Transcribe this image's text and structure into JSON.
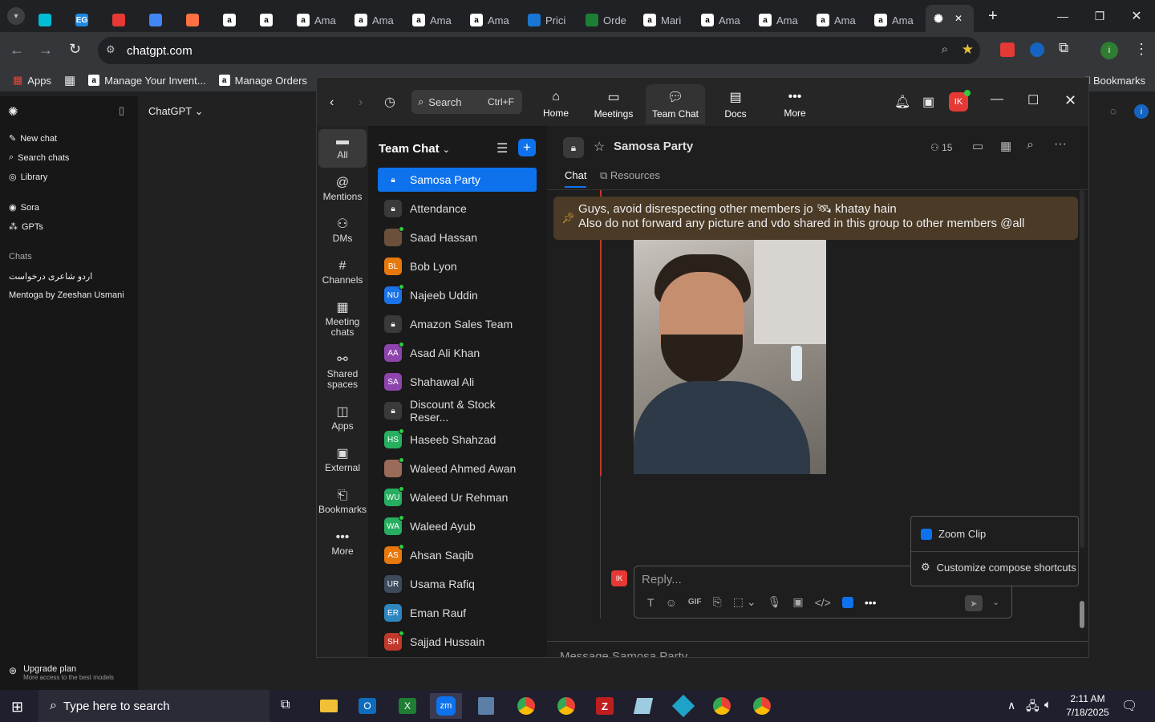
{
  "browser": {
    "tabs": [
      {
        "label": "",
        "icon": "tab-list-icon"
      },
      {
        "label": "",
        "color": "#00bcd4"
      },
      {
        "label": "",
        "color": "#1e88e5",
        "text": "EG"
      },
      {
        "label": "",
        "color": "#e53935"
      },
      {
        "label": "",
        "color": "#4285f4"
      },
      {
        "label": "",
        "color": "#ff7043"
      },
      {
        "label": "",
        "color": "#222"
      },
      {
        "label": "",
        "color": "#222"
      },
      {
        "label": "Ama",
        "color": "#222"
      },
      {
        "label": "Ama",
        "color": "#222"
      },
      {
        "label": "Ama",
        "color": "#222"
      },
      {
        "label": "Ama",
        "color": "#222"
      },
      {
        "label": "Prici",
        "color": "#1976d2"
      },
      {
        "label": "Orde",
        "color": "#1e7e34"
      },
      {
        "label": "Mari",
        "color": "#222"
      },
      {
        "label": "Ama",
        "color": "#222"
      },
      {
        "label": "Ama",
        "color": "#222"
      },
      {
        "label": "Ama",
        "color": "#222"
      },
      {
        "label": "Ama",
        "color": "#222"
      },
      {
        "label": "",
        "color": "#fff",
        "active": true
      }
    ],
    "url": "chatgpt.com",
    "bookmarks": [
      {
        "label": "Apps"
      },
      {
        "label": ""
      },
      {
        "label": "Manage Your Invent..."
      },
      {
        "label": "Manage Orders"
      }
    ],
    "all_bookmarks": "All Bookmarks"
  },
  "chatgpt": {
    "title": "ChatGPT",
    "new_chat": "New chat",
    "search_chats": "Search chats",
    "library": "Library",
    "sora": "Sora",
    "gpts": "GPTs",
    "chats_label": "Chats",
    "chats": [
      "اردو شاعری درخواست",
      "Mentoga by Zeeshan Usmani"
    ],
    "upgrade": "Upgrade plan",
    "upgrade_sub": "More access to the best models"
  },
  "zoom": {
    "search": "Search",
    "search_shortcut": "Ctrl+F",
    "nav": [
      {
        "label": "Home",
        "icon": "home-icon"
      },
      {
        "label": "Meetings",
        "icon": "video-icon"
      },
      {
        "label": "Team Chat",
        "icon": "chat-bubbles-icon",
        "active": true
      },
      {
        "label": "Docs",
        "icon": "docs-icon"
      },
      {
        "label": "More",
        "icon": "more-dots-icon"
      }
    ],
    "profile_initials": "IK",
    "rail": [
      {
        "label": "All",
        "icon": "chat-icon",
        "active": true
      },
      {
        "label": "Mentions",
        "icon": "at-icon"
      },
      {
        "label": "DMs",
        "icon": "people-icon"
      },
      {
        "label": "Channels",
        "icon": "hash-icon"
      },
      {
        "label": "Meeting chats",
        "icon": "calendar-icon"
      },
      {
        "label": "Shared spaces",
        "icon": "share-icon"
      },
      {
        "label": "Apps",
        "icon": "apps-icon"
      },
      {
        "label": "External",
        "icon": "external-icon"
      },
      {
        "label": "Bookmarks",
        "icon": "bookmark-icon"
      },
      {
        "label": "More",
        "icon": "more-dots-icon"
      }
    ],
    "list_title": "Team Chat",
    "channels": [
      {
        "name": "Samosa Party",
        "type": "lock",
        "selected": true
      },
      {
        "name": "Attendance",
        "type": "lock"
      },
      {
        "name": "Saad Hassan",
        "initials": "",
        "color": "#6b4f3a",
        "online": true
      },
      {
        "name": "Bob Lyon",
        "initials": "BL",
        "color": "#e8780c",
        "online": false
      },
      {
        "name": "Najeeb Uddin",
        "initials": "NU",
        "color": "#1a73e8",
        "online": true
      },
      {
        "name": "Amazon Sales Team",
        "type": "lock"
      },
      {
        "name": "Asad Ali Khan",
        "initials": "AA",
        "color": "#8e44ad",
        "online": true
      },
      {
        "name": "Shahawal Ali",
        "initials": "SA",
        "color": "#8e44ad",
        "online": false
      },
      {
        "name": "Discount & Stock Reser...",
        "type": "lock"
      },
      {
        "name": "Haseeb Shahzad",
        "initials": "HS",
        "color": "#27ae60",
        "online": true
      },
      {
        "name": "Waleed Ahmed Awan",
        "initials": "",
        "color": "#9b6b5a",
        "online": true
      },
      {
        "name": "Waleed Ur Rehman",
        "initials": "WU",
        "color": "#27ae60",
        "online": true
      },
      {
        "name": "Waleed Ayub",
        "initials": "WA",
        "color": "#27ae60",
        "online": true
      },
      {
        "name": "Ahsan Saqib",
        "initials": "AS",
        "color": "#e8780c",
        "online": true
      },
      {
        "name": "Usama Rafiq",
        "initials": "UR",
        "color": "#3d4a5c",
        "online": false
      },
      {
        "name": "Eman Rauf",
        "initials": "ER",
        "color": "#2e86c1",
        "online": false
      },
      {
        "name": "Sajjad Hussain",
        "initials": "SH",
        "color": "#c0392b",
        "online": true
      }
    ],
    "chat_title": "Samosa Party",
    "member_count": "15",
    "tabs": [
      "Chat",
      "Resources"
    ],
    "pinned_line1": "Guys, avoid disrespecting other members jo 🛰 khatay hain",
    "pinned_line2": "Also do not forward any picture and vdo shared in this group to other members @all",
    "reply_placeholder": "Reply...",
    "reply_avatar": "IK",
    "compose_placeholder": "Message Samosa Party",
    "popup": {
      "item1": "Zoom Clip",
      "item2": "Customize compose shortcuts"
    },
    "colors": {
      "accent": "#0e72ed",
      "pinned_bg": "#4a3a26"
    }
  },
  "taskbar": {
    "search_placeholder": "Type here to search",
    "time": "2:11 AM",
    "date": "7/18/2025"
  }
}
